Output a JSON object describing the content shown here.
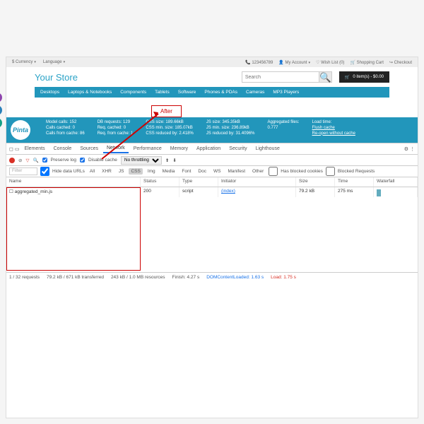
{
  "topbar": {
    "currency": "$ Currency",
    "language": "Language",
    "phone": "123456789",
    "account": "My Account",
    "wishlist": "Wish List (0)",
    "cart": "Shopping Cart",
    "checkout": "Checkout"
  },
  "store": {
    "title": "Your Store",
    "search_placeholder": "Search",
    "cart_label": "0 item(s) - $0.00"
  },
  "nav": [
    "Desktops",
    "Laptops & Notebooks",
    "Components",
    "Tablets",
    "Software",
    "Phones & PDAs",
    "Cameras",
    "MP3 Players"
  ],
  "annotation": {
    "label": "After"
  },
  "stats": {
    "brand": "Pinta",
    "c1": [
      "Model calls: 152",
      "Calls cached: 0",
      "Calls from cache: 86"
    ],
    "c2": [
      "DB requests: 129",
      "Req. cached: 0",
      "Req. from cache: 1"
    ],
    "c3": [
      "CSS size: 189.66kB",
      "CSS min. size: 185.07kB",
      "CSS reduced by: 2.418%"
    ],
    "c4": [
      "JS size: 345.35kB",
      "JS min. size: 236.89kB",
      "JS reduced by: 31.4096%"
    ],
    "c5": [
      "Aggregated files:",
      "0.777"
    ],
    "c6": [
      "Load time:",
      "Flush cache",
      "Re-open without cache"
    ]
  },
  "devtools": {
    "tabs": [
      "Elements",
      "Console",
      "Sources",
      "Network",
      "Performance",
      "Memory",
      "Application",
      "Security",
      "Lighthouse"
    ],
    "active_tab": "Network",
    "preserve_log": "Preserve log",
    "disable_cache": "Disable cache",
    "throttling": "No throttling",
    "filter_placeholder": "Filter",
    "hide_data": "Hide data URLs",
    "filter_tabs": [
      "All",
      "XHR",
      "JS",
      "CSS",
      "Img",
      "Media",
      "Font",
      "Doc",
      "WS",
      "Manifest",
      "Other"
    ],
    "filter_sel": "CSS",
    "blocked_cookies": "Has blocked cookies",
    "blocked_req": "Blocked Requests",
    "columns": {
      "name": "Name",
      "status": "Status",
      "type": "Type",
      "initiator": "Initiator",
      "size": "Size",
      "time": "Time",
      "waterfall": "Waterfall"
    },
    "rows": [
      {
        "name": "aggregated_min.js",
        "status": "200",
        "type": "script",
        "initiator": "(index)",
        "size": "79.2 kB",
        "time": "275 ms"
      }
    ],
    "status": {
      "req": "1 / 32 requests",
      "xfer": "79.2 kB / 671 kB transferred",
      "res": "243 kB / 1.0 MB resources",
      "finish": "Finish: 4.27 s",
      "dcl": "DOMContentLoaded: 1.63 s",
      "load": "Load: 1.75 s"
    }
  }
}
